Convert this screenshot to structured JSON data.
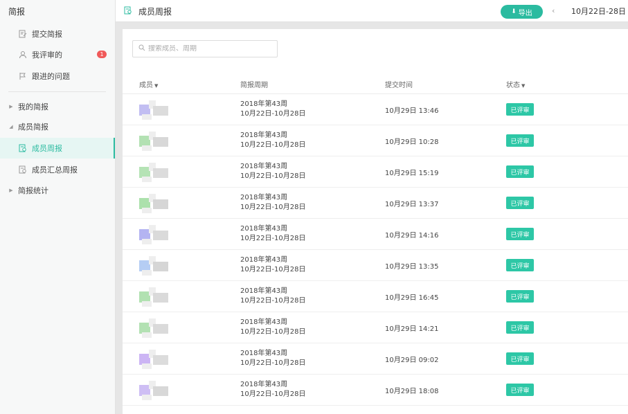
{
  "sidebar": {
    "title": "简报",
    "items": [
      {
        "label": "提交简报",
        "icon": "edit-report-icon"
      },
      {
        "label": "我评审的",
        "icon": "review-icon",
        "badge": "1"
      },
      {
        "label": "跟进的问题",
        "icon": "flag-icon"
      }
    ],
    "groups": [
      {
        "label": "我的简报",
        "expanded": false
      },
      {
        "label": "成员简报",
        "expanded": true,
        "children": [
          {
            "label": "成员周报",
            "icon": "member-report-icon",
            "active": true
          },
          {
            "label": "成员汇总周报",
            "icon": "summary-report-icon",
            "active": false
          }
        ]
      },
      {
        "label": "简报统计",
        "expanded": false
      }
    ]
  },
  "header": {
    "title": "成员周报",
    "export_label": "导出",
    "week_label": "10月22日-28日"
  },
  "search": {
    "placeholder": "搜索成员、周期",
    "value": ""
  },
  "table": {
    "columns": {
      "member": "成员",
      "period": "简报周期",
      "submitted": "提交时间",
      "status": "状态"
    },
    "rows": [
      {
        "period_line1": "2018年第43周",
        "period_line2": "10月22日-10月28日",
        "time": "10月29日 13:46",
        "status": "已评审"
      },
      {
        "period_line1": "2018年第43周",
        "period_line2": "10月22日-10月28日",
        "time": "10月29日 10:28",
        "status": "已评审"
      },
      {
        "period_line1": "2018年第43周",
        "period_line2": "10月22日-10月28日",
        "time": "10月29日 15:19",
        "status": "已评审"
      },
      {
        "period_line1": "2018年第43周",
        "period_line2": "10月22日-10月28日",
        "time": "10月29日 13:37",
        "status": "已评审"
      },
      {
        "period_line1": "2018年第43周",
        "period_line2": "10月22日-10月28日",
        "time": "10月29日 14:16",
        "status": "已评审"
      },
      {
        "period_line1": "2018年第43周",
        "period_line2": "10月22日-10月28日",
        "time": "10月29日 13:35",
        "status": "已评审"
      },
      {
        "period_line1": "2018年第43周",
        "period_line2": "10月22日-10月28日",
        "time": "10月29日 16:45",
        "status": "已评审"
      },
      {
        "period_line1": "2018年第43周",
        "period_line2": "10月22日-10月28日",
        "time": "10月29日 14:21",
        "status": "已评审"
      },
      {
        "period_line1": "2018年第43周",
        "period_line2": "10月22日-10月28日",
        "time": "10月29日 09:02",
        "status": "已评审"
      },
      {
        "period_line1": "2018年第43周",
        "period_line2": "10月22日-10月28日",
        "time": "10月29日 18:08",
        "status": "已评审"
      }
    ]
  },
  "colors": {
    "accent": "#2bbba0",
    "status_bg": "#2dc7a6",
    "badge": "#f05a5a"
  }
}
